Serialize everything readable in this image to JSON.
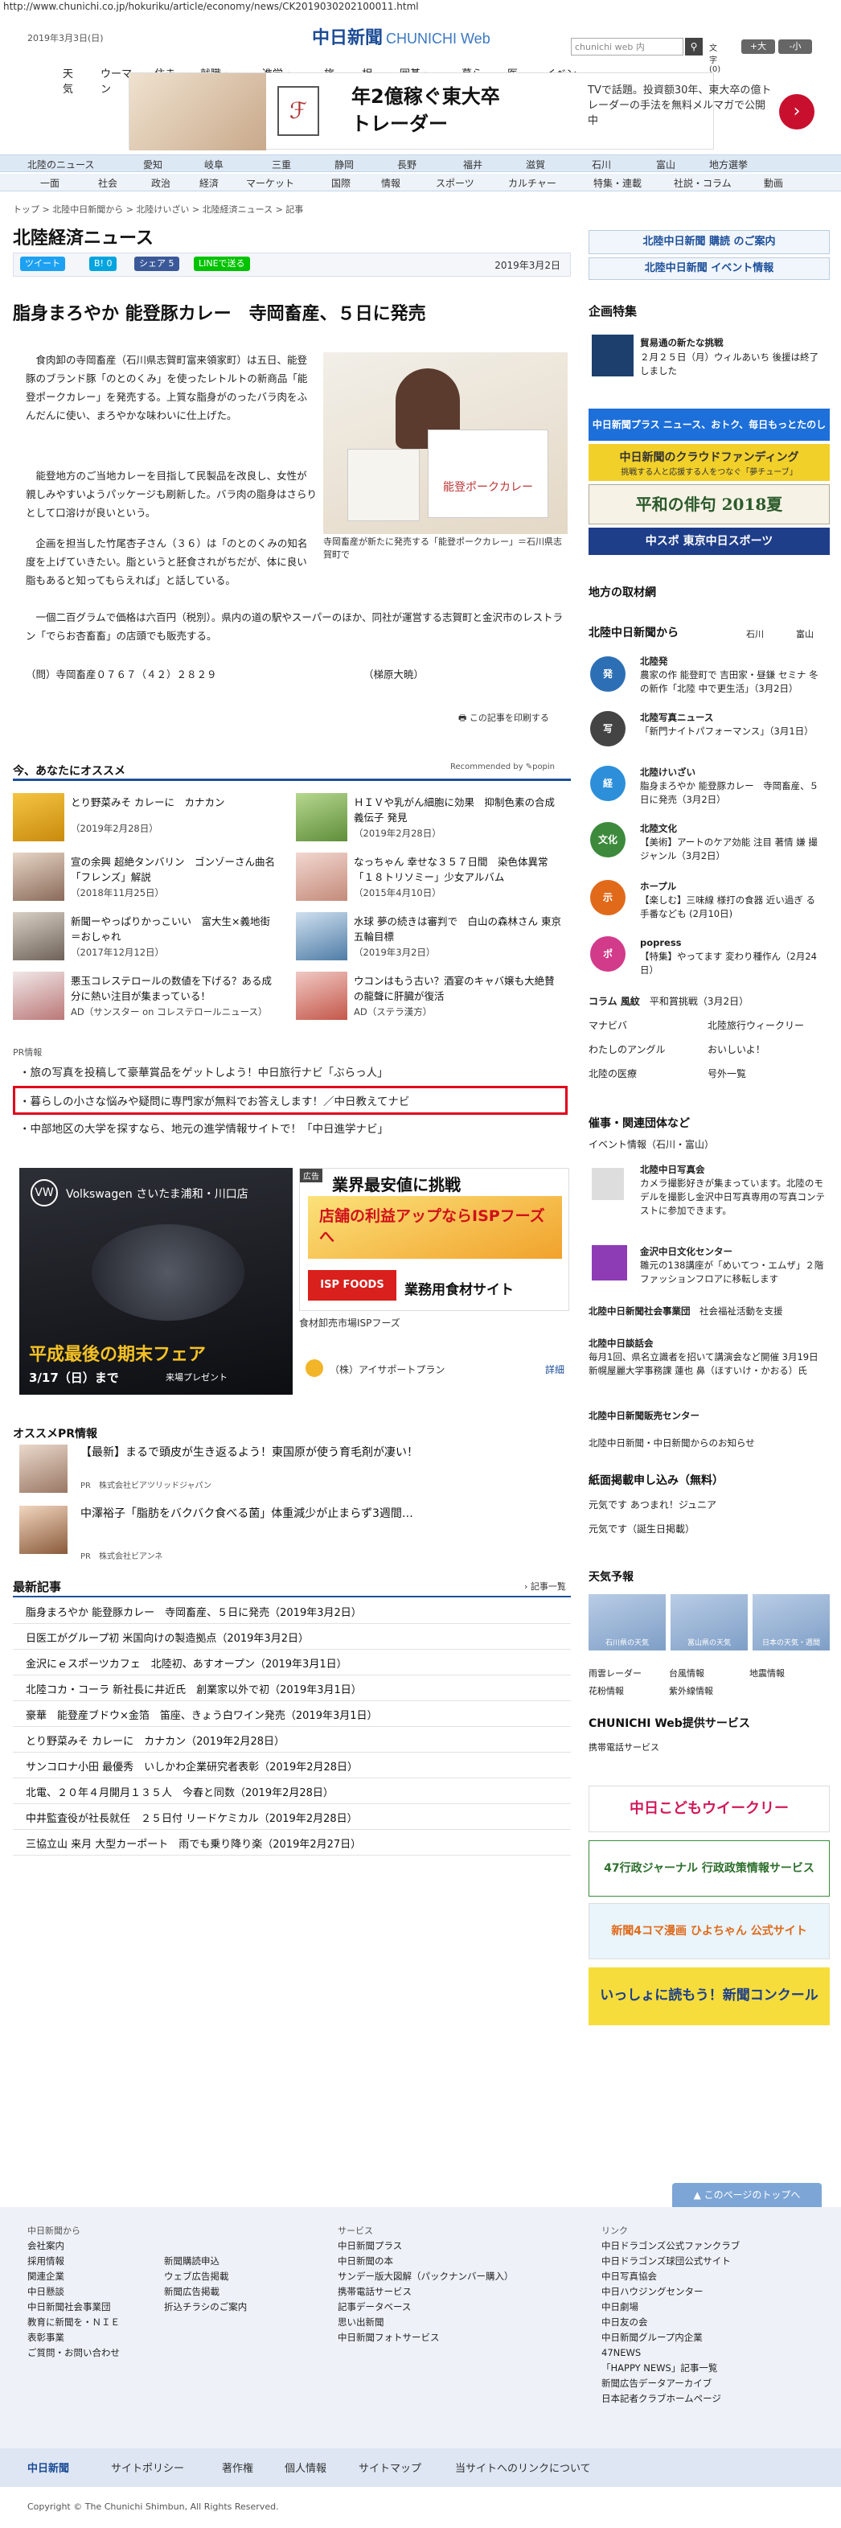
{
  "url": "http://www.chunichi.co.jp/hokuriku/article/economy/news/CK2019030202100011.html",
  "header": {
    "date": "2019年3月3日(日)",
    "logo_main": "中日新聞",
    "logo_sub": "CHUNICHI Web",
    "search_placeholder": "chunichi web 内",
    "font_size_label": "文字",
    "font_size_value": "(0)",
    "font_up": "+大",
    "font_down": "-小",
    "nav": [
      "天気",
      "ウーマン",
      "住まい",
      "就職・転職",
      "進学・教育",
      "旅行",
      "相談",
      "囲碁・将棋",
      "暮らし",
      "医療",
      "イベント"
    ]
  },
  "ad": {
    "headline_line1": "年2億稼ぐ東大卒",
    "headline_line2": "トレーダー",
    "body": "TVで話題。投資额30年、東大卒の億トレーダーの手法を無料メルマガで公開中"
  },
  "categories_row1": [
    "北陸のニュース",
    "愛知",
    "岐阜",
    "三重",
    "静岡",
    "長野",
    "福井",
    "滋賀",
    "石川",
    "富山",
    "地方選挙"
  ],
  "categories_row2": [
    "一面",
    "社会",
    "政治",
    "経済",
    "マーケット",
    "国際",
    "情報",
    "スポーツ",
    "カルチャー",
    "特集・連載",
    "社説・コラム",
    "動画"
  ],
  "breadcrumb": "トップ > 北陸中日新聞から > 北陸けいざい > 北陸経済ニュース > 記事",
  "section_title": "北陸経済ニュース",
  "share": {
    "tweet": "ツイート",
    "hatena": "B! 0",
    "facebook": "シェア 5",
    "line": "LINEで送る"
  },
  "article": {
    "date": "2019年3月2日",
    "headline": "脂身まろやか 能登豚カレー　寺岡畜産、５日に発売",
    "paragraphs": [
      "　食肉卸の寺岡畜産（石川県志賀町富来領家町）は五日、能登豚のブランド豚「のとのくみ」を使ったレトルトの新商品「能登ポークカレー」を発売する。上質な脂身がのったバラ肉をふんだんに使い、まろやかな味わいに仕上げた。",
      "　能登地方のご当地カレーを目指して民製品を改良し、女性が親しみやすいようパッケージも刷新した。バラ肉の脂身はさらりとして口溶けが良いという。",
      "　企画を担当した竹尾杏子さん（３６）は「のとのくみの知名度を上げていきたい。脂というと胚食されがちだが、体に良い脂もあると知ってもらえれば」と話している。"
    ],
    "paragraph_full": "　一個二百グラムで価格は六百円（税別）。県内の道の駅やスーパーのほか、同社が運営する志賀町と金沢市のレストラン「でらお杏畜畜」の店頭でも販売する。",
    "contact": "（問）寺岡畜産０７６７（４２）２８２９",
    "author": "（梯原大暁）",
    "photo_caption": "寺岡畜産が新たに発売する「能登ポークカレー」＝石川県志賀町で",
    "photo_title": "能登ポークカレー",
    "print_label": "この記事を印刷する"
  },
  "recommend": {
    "heading": "今、あなたにオススメ",
    "popin": "Recommended by ✎popin",
    "items": [
      {
        "title": "とり野菜みそ カレーに　カナカン",
        "sub": "（2019年2月28日）"
      },
      {
        "title": "ＨＩＶや乳がん細胞に効果　抑制色素の合成義伝子 発見",
        "sub": "（2019年2月28日）"
      },
      {
        "title": "宣の余興 超絶タンバリン　ゴンゾーさん曲名「フレンズ」解説",
        "sub": "（2018年11月25日）"
      },
      {
        "title": "なっちゃん 幸せな３５７日間　染色体異常「１８トリソミー」少女アルバム",
        "sub": "（2015年4月10日）"
      },
      {
        "title": "新聞ーやっぱりかっこいい　富大生×義地街＝おしゃれ",
        "sub": "（2017年12月12日）"
      },
      {
        "title": "水球 夢の続きは審判で　白山の森林さん 東京五輪目標",
        "sub": "（2019年3月2日）"
      },
      {
        "title": "悪玉コレステロールの数値を下げる？ある成分に熱い注目が集まっている！",
        "sub": "AD（サンスター on コレステロールニュース）"
      },
      {
        "title": "ウコンはもう古い？酒宴のキャバ嬢も大絶賛の龍聲に肝臓が復活",
        "sub": "AD（ステラ漢方）"
      }
    ]
  },
  "pr": {
    "label": "PR情報",
    "links": [
      "旅の写真を投稿して豪華賞品をゲットしよう！中日旅行ナビ「ぶらっ人」",
      "暮らしの小さな悩みや疑問に専門家が無料でお答えします！／中日教えてナビ",
      "中部地区の大学を探すなら、地元の進学情報サイトで！「中日進学ナビ」"
    ]
  },
  "vw_ad": {
    "brand": "Volkswagen さいたま浦和・川口店",
    "headline": "平成最後の期末フェア",
    "date": "3/17（日）まで",
    "gift": "来場プレゼント"
  },
  "isp_ad": {
    "label": "広告",
    "line1": "業界最安値に挑戦",
    "line2": "店舗の利益アップならISPフーズへ",
    "logo": "ISP FOODS",
    "tagline": "業務用食材サイト",
    "caption": "食材卸売市場ISPフーズ",
    "sponsor": "（株）アイサポートプラン",
    "detail": "詳細"
  },
  "oss_pr": {
    "heading": "オススメPR情報",
    "items": [
      {
        "title": "【最新】まるで頭皮が生き返るよう！東国原が使う育毛剤が凄い！",
        "sub": "PR　株式会社ビアツリッドジャパン"
      },
      {
        "title": "中澤裕子「脂肪をバクバク食べる菌」体重減少が止まらず3週間…",
        "sub": "PR　株式会社ビアンネ"
      }
    ]
  },
  "latest": {
    "heading": "最新記事",
    "more": "記事一覧",
    "items": [
      "脂身まろやか 能登豚カレー　寺岡畜産、５日に発売（2019年3月2日）",
      "日医工がグループ初 米国向けの製造拠点（2019年3月2日）",
      "金沢にｅスポーツカフェ　北陸初、あすオープン（2019年3月1日）",
      "北陸コカ・コーラ 新社長に井近氏　創業家以外で初（2019年3月1日）",
      "豪華　能登産ブドウ×金箔　笛座、きょう白ワイン発売（2019年3月1日）",
      "とり野菜みそ カレーに　カナカン（2019年2月28日）",
      "サンコロナ小田 最優秀　いしかわ企業研究者表彰（2019年2月28日）",
      "北電、２０年４月開月１３５人　今春と同数（2019年2月28日）",
      "中井監査役が社長就任　２５日付 リードケミカル（2019年2月28日）",
      "三協立山 来月 大型カーポート　雨でも乗り降り楽（2019年2月27日）"
    ]
  },
  "sidebar": {
    "hokuriku_banner": "北陸中日新聞 購読 のご案内",
    "event_banner": "北陸中日新聞 イベント情報",
    "kikaku_h": "企画特集",
    "kikaku_title": "貿易通の新たな挑戦",
    "kikaku_sub": "２月２５日（月）ウィルあいち 後援は終了しました",
    "plus_banner": "中日新聞プラス ニュース、おトク、毎日もっとたのしく",
    "crowd_banner": "中日新聞のクラウドファンディング",
    "crowd_sub": "挑戦する人と応援する人をつなぐ「夢チューブ」",
    "haiku_banner": "平和の俳句 2018夏",
    "sports_banner": "中スポ 東京中日スポーツ",
    "local_h": "地方の取材網",
    "hokuriku_h": "北陸中日新聞から",
    "hokuriku_links": [
      "石川",
      "富山"
    ],
    "items": [
      {
        "icon": "発",
        "color": "#2d6fb4",
        "title": "北陸発",
        "text": "農家の作 能登町で 吉田家・昼鎌 セミナ 冬の新作「北陸 中で更生活」（3月2日）"
      },
      {
        "icon": "写",
        "color": "#444",
        "title": "北陸写真ニュース",
        "text": "「新門ナイトパフォーマンス」（3月1日）"
      },
      {
        "icon": "経",
        "color": "#2d8fd9",
        "title": "北陸けいざい",
        "text": "脂身まろやか 能登豚カレー　寺岡畜産、５日に発売（3月2日）"
      },
      {
        "icon": "文化",
        "color": "#3d8a3d",
        "title": "北陸文化",
        "text": "【美術】アートのケア効能 注目 著情 嫌 撮 ジャンル（3月2日）"
      },
      {
        "icon": "示",
        "color": "#e06a1a",
        "title": "ホープル",
        "text": "【楽しむ】三味線 様打の食器 近い過ぎ る 手番なども (2月10日)"
      },
      {
        "icon": "ポ",
        "color": "#d23a8a",
        "title": "popress",
        "text": "【特集】やってます 変わり種作ん（2月24日）"
      }
    ],
    "column_label": "コラム 風紋",
    "column_text": "平和賞挑戦（3月2日）",
    "pickup": [
      "マナビバ",
      "北陸旅行ウィークリー",
      "わたしのアングル",
      "おいしいよ！",
      "北陸の医療",
      "号外一覧"
    ],
    "events_h": "催事・関連団体など",
    "events_sub": "イベント情報（石川・富山）",
    "events": [
      {
        "title": "北陸中日写真会",
        "text": "カメラ撮影好きが集まっています。北陸のモデルを撮影し金沢中日写真専用の写真コンテストに参加できます。"
      },
      {
        "title": "金沢中日文化センター",
        "text": "雛元の138講座が「めいてつ・エムザ」２階ファッションフロアに移転します"
      },
      {
        "title": "北陸中日新聞社会事業団",
        "text": "社会福祉活動を支援"
      },
      {
        "title": "北陸中日談話会",
        "text": "毎月1回、県名立識者を招いて講演会など開催 3月19日 新幌屋麗大学事務課 蓮也 鼻（ほすいけ・かおる）氏"
      },
      {
        "title": "北陸中日新聞販売センター",
        "text": ""
      }
    ],
    "hokuriku_notice": "北陸中日新聞・中日新聞からのお知らせ",
    "moushikomi_h": "紙面掲載申し込み（無料）",
    "moushikomi": [
      "元気です あつまれ！ジュニア",
      "元気です（誕生日掲載）"
    ],
    "weather_h": "天気予報",
    "weather_tiles": [
      "石川県の天気",
      "富山県の天気",
      "日本の天気・週間"
    ],
    "weather_links": [
      "雨雲レーダー",
      "台風情報",
      "地震情報",
      "花粉情報",
      "紫外線情報"
    ],
    "web_h": "CHUNICHI Web提供サービス",
    "web_sub": "携帯電話サービス",
    "kodomo_banner": "中日こどもウイークリー",
    "gyosei_banner": "47行政ジャーナル 行政政策情報サービス",
    "hiyoko_banner": "新聞4コマ漫画 ひよちゃん 公式サイト",
    "concours_banner": "いっしょに読もう！新聞コンクール"
  },
  "footer": {
    "pagetop": "このページのトップへ",
    "col1": {
      "h": "中日新聞から",
      "items": [
        "会社案内",
        "採用情報",
        "関連企業",
        "中日懸談",
        "中日新聞社会事業団",
        "教育に新聞を・ＮＩＥ",
        "表彰事業",
        "ご質問・お問い合わせ"
      ]
    },
    "col2": {
      "items": [
        "新聞購読申込",
        "ウェブ広告掲載",
        "新聞広告掲載",
        "折込チラシのご案内"
      ]
    },
    "col3": {
      "h": "サービス",
      "items": [
        "中日新聞プラス",
        "中日新聞の本",
        "サンデー版大図解（パックナンバー購入）",
        "携帯電話サービス",
        "記事データベース",
        "思い出新聞",
        "中日新聞フォトサービス"
      ]
    },
    "col4": {
      "h": "リンク",
      "items": [
        "中日ドラゴンズ公式ファンクラブ",
        "中日ドラゴンズ球団公式サイト",
        "中日写真協会",
        "中日ハウジングセンター",
        "中日劇場",
        "中日友の会",
        "中日新聞グループ内企業",
        "47NEWS",
        "「HAPPY NEWS」記事一覧",
        "新聞広告データアーカイブ",
        "日本記者クラブホームページ"
      ]
    },
    "bar": [
      "中日新聞",
      "サイトポリシー",
      "著作権",
      "個人情報",
      "サイトマップ",
      "当サイトへのリンクについて"
    ],
    "copyright": "Copyright © The Chunichi Shimbun, All Rights Reserved."
  }
}
